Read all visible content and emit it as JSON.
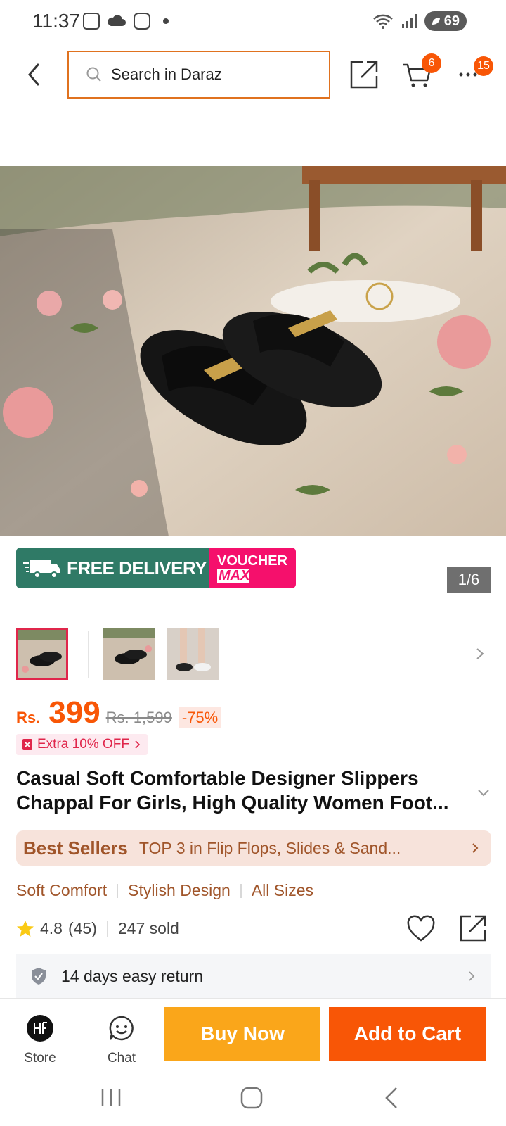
{
  "status_bar": {
    "time": "11:37",
    "battery": "69"
  },
  "header": {
    "search_placeholder": "Search in Daraz",
    "cart_badge": "6",
    "more_badge": "15"
  },
  "promo": {
    "free_tag": "FREE",
    "free_delivery": "FREE DELIVERY",
    "voucher_line1": "VOUCHER",
    "voucher_line2": "MAX"
  },
  "gallery": {
    "counter": "1/6"
  },
  "price": {
    "currency": "Rs.",
    "value": "399",
    "original": "Rs. 1,599",
    "discount": "-75%",
    "extra_off": "Extra 10% OFF"
  },
  "product": {
    "title": "Casual Soft Comfortable Designer Slippers Chappal For Girls, High Quality Women Foot..."
  },
  "best_sellers": {
    "label": "Best Sellers",
    "text": "TOP 3 in Flip Flops, Slides & Sand..."
  },
  "features": [
    "Soft Comfort",
    "Stylish Design",
    "All Sizes"
  ],
  "rating": {
    "score": "4.8",
    "count": "(45)",
    "sold": "247 sold"
  },
  "return_policy": {
    "text": "14 days easy return"
  },
  "bottom_bar": {
    "store": "Store",
    "chat": "Chat",
    "buy_now": "Buy Now",
    "add_to_cart": "Add to Cart"
  },
  "colors": {
    "brand_orange": "#f85606",
    "buy_now": "#faa61a",
    "free_delivery": "#2f7a66",
    "voucher": "#f5106c"
  }
}
